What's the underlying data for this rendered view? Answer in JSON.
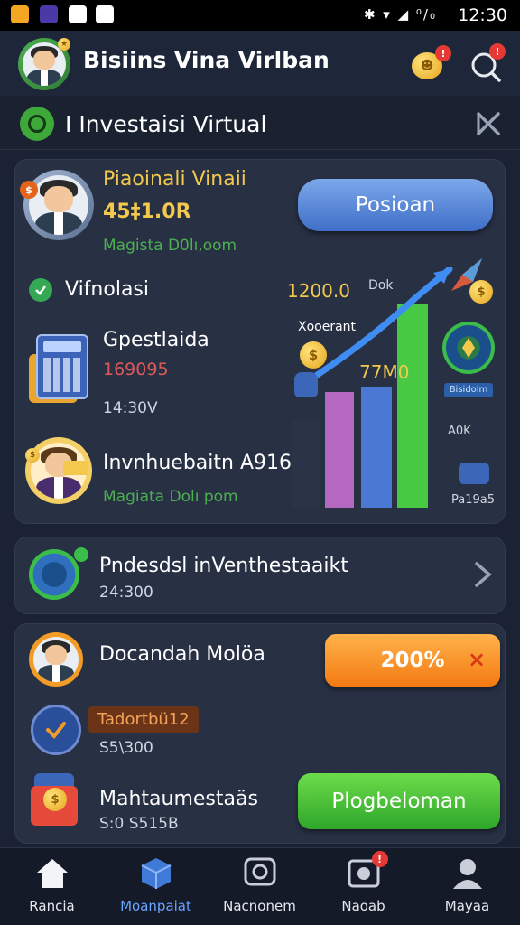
{
  "status_bar": {
    "time": "12:30",
    "icons_text": "✱ ▾ ◢ ⁰/₀"
  },
  "header": {
    "title": "Bisiins Vina Virlban",
    "notif_badge": "!",
    "search_badge": "!"
  },
  "section": {
    "title": "I Investaisi Virtual"
  },
  "card1": {
    "name": "Piaoinali Vinaii",
    "amount": "45‡1.0R",
    "link": "Magista D0lı,oom",
    "button": "Posioan",
    "check_label": "Vifnolasi",
    "chart_value_1": "1200.0",
    "chart_small": "Dok",
    "chart_label_1": "Xooerant",
    "chart_value_2": "77M0",
    "chart_small_2": "A0K",
    "chart_small_3": "Pa19a5",
    "badge_chip": "Bisidolm",
    "item_title": "Gpestlaida",
    "item_value": "169095",
    "item_time": "14:30V",
    "person_title": "Invnhuebaitn A916",
    "person_link": "Magiata Dolı pom"
  },
  "card2": {
    "title": "Pndesdsl inVenthestaaikt",
    "value": "24:300"
  },
  "card3": {
    "person_title": "Docandah Molöa",
    "button_orange": "200%",
    "button_orange_close": "×",
    "chip_label": "Tadortbü12",
    "value_1": "S5\\300",
    "item_title": "Mahtaumestaäs",
    "value_2": "S:0 S515B",
    "button_green": "Plogbeloman"
  },
  "bottom_nav": [
    {
      "label": "Rancia",
      "icon": "home-icon",
      "active": false
    },
    {
      "label": "Moanpaiat",
      "icon": "box-icon",
      "active": true
    },
    {
      "label": "Nacnonem",
      "icon": "chat-icon",
      "active": false
    },
    {
      "label": "Naoab",
      "icon": "camera-icon",
      "active": false,
      "badge": "!"
    },
    {
      "label": "Mayaa",
      "icon": "profile-icon",
      "active": false
    }
  ],
  "colors": {
    "background": "#1b2233",
    "card": "#283044",
    "gold": "#f2c94c",
    "green": "#4caf50",
    "accent_blue": "#6aa4ff",
    "red": "#e05a5a"
  }
}
